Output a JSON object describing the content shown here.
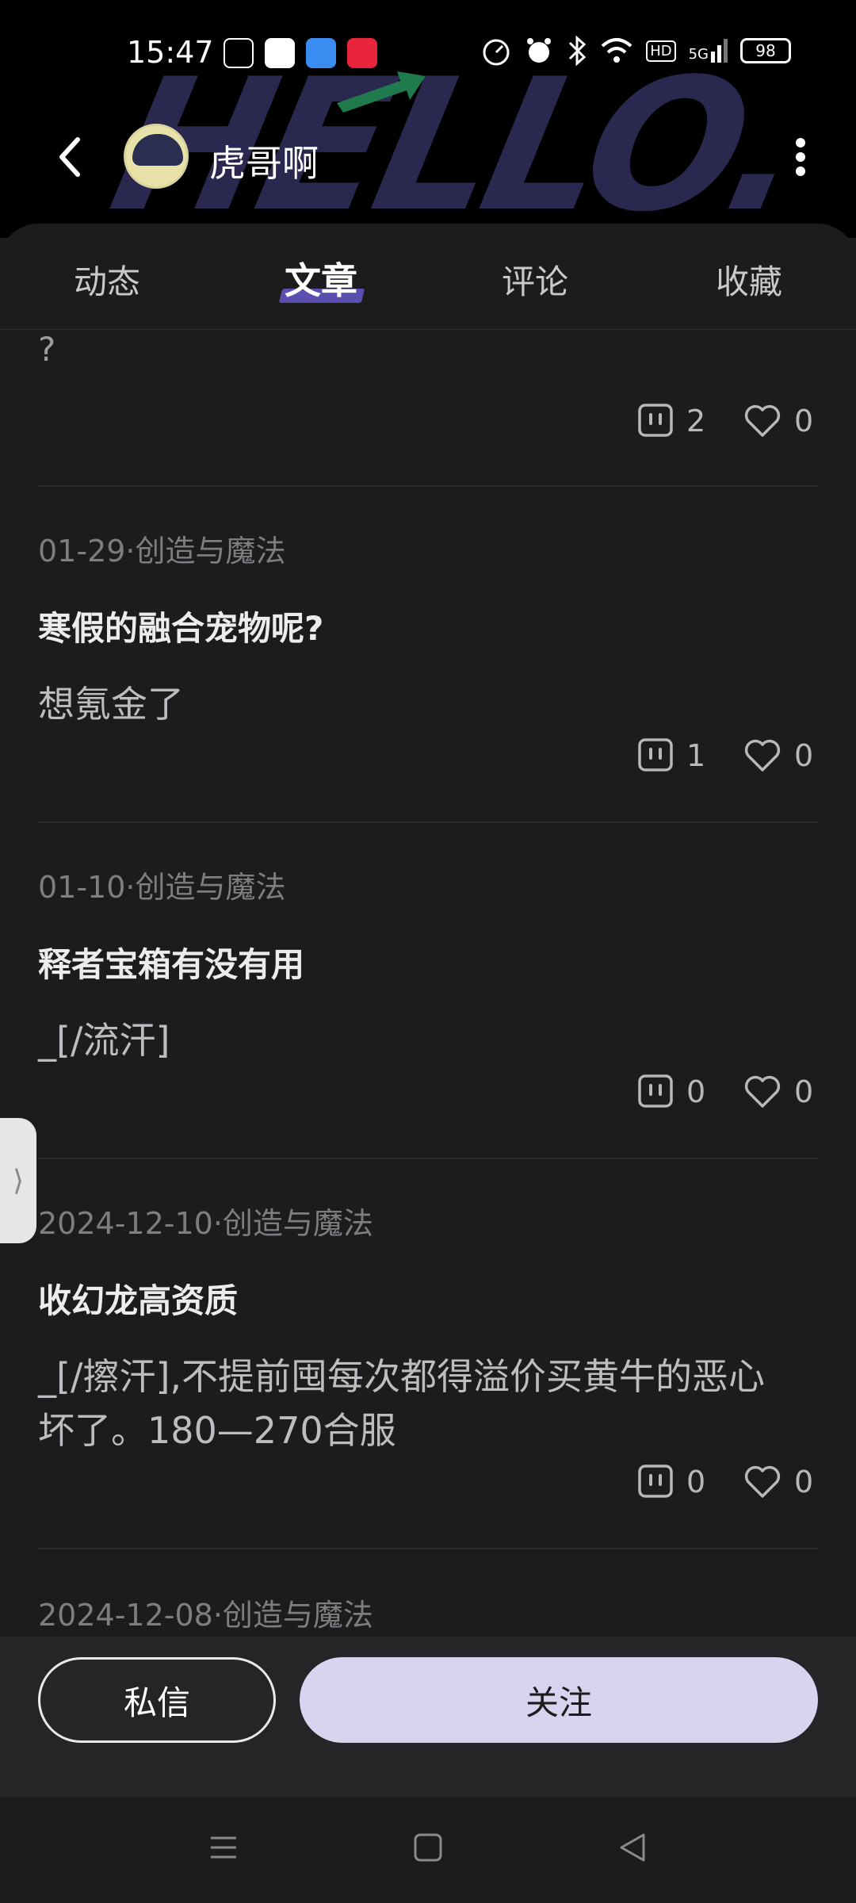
{
  "status_bar": {
    "time": "15:47",
    "battery": "98",
    "network": "5G",
    "hd": "HD"
  },
  "header": {
    "user_name": "虎哥啊",
    "watermark": "HELLO."
  },
  "tabs": [
    {
      "label": "动态"
    },
    {
      "label": "文章"
    },
    {
      "label": "评论"
    },
    {
      "label": "收藏"
    }
  ],
  "active_tab": "文章",
  "post_fragment": {
    "text": "?",
    "comments": "2",
    "likes": "0"
  },
  "posts": [
    {
      "meta": "01-29·创造与魔法",
      "title": "寒假的融合宠物呢?",
      "body": "想氪金了",
      "comments": "1",
      "likes": "0"
    },
    {
      "meta": "01-10·创造与魔法",
      "title": "释者宝箱有没有用",
      "body": "_[/流汗]",
      "comments": "0",
      "likes": "0"
    },
    {
      "meta": "2024-12-10·创造与魔法",
      "title": "收幻龙高资质",
      "body_line1": "_[/擦汗],不提前囤每次都得溢价买黄牛的恶心",
      "body_line2": "坏了。180—270合服",
      "comments": "0",
      "likes": "0"
    },
    {
      "meta": "2024-12-08·创造与魔法"
    }
  ],
  "actions": {
    "message": "私信",
    "follow": "关注"
  },
  "side_handle": "⟩",
  "colors": {
    "background": "#1c1c1d",
    "accent": "#5a4fb0",
    "follow_button": "#d8d3ef"
  }
}
